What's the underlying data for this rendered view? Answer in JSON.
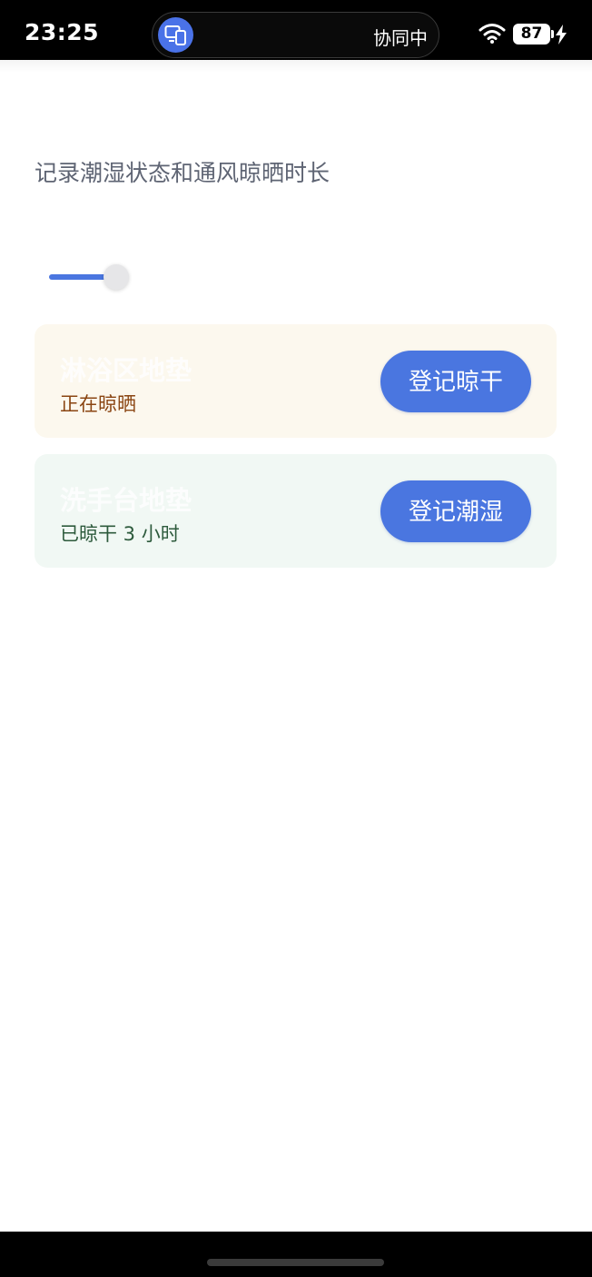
{
  "status_bar": {
    "time": "23:25",
    "collab_label": "协同中",
    "battery": "87"
  },
  "page": {
    "subtitle": "记录潮湿状态和通风晾晒时长"
  },
  "cards": [
    {
      "title": "淋浴区地垫",
      "status": "正在晾晒",
      "button_label": "登记晾干"
    },
    {
      "title": "洗手台地垫",
      "status": "已晾干 3 小时",
      "button_label": "登记潮湿"
    }
  ],
  "colors": {
    "accent": "#4a76e0",
    "card_drying_bg": "#fcf8ee",
    "card_dry_bg": "#f1f8f4",
    "status_drying": "#8a4512",
    "status_dry": "#2d5a3c"
  }
}
